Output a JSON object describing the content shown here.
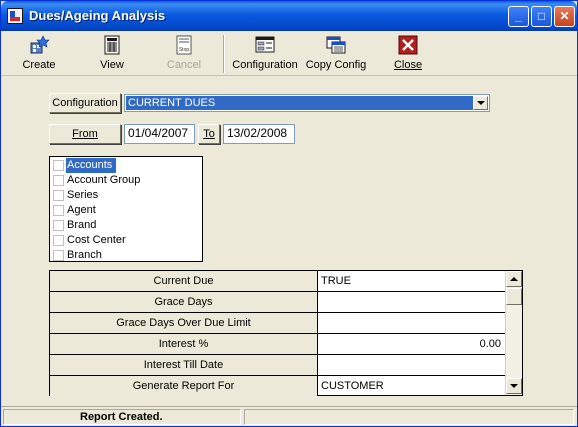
{
  "window": {
    "title": "Dues/Ageing Analysis"
  },
  "titlebar_buttons": {
    "minimize": "_",
    "maximize": "□",
    "close": "✕"
  },
  "toolbar": {
    "items": [
      {
        "label": "Create",
        "icon": "create-icon",
        "enabled": true
      },
      {
        "label": "View",
        "icon": "view-icon",
        "enabled": true
      },
      {
        "label": "Cancel",
        "icon": "cancel-icon",
        "enabled": false
      },
      {
        "label": "Configuration",
        "icon": "configuration-icon",
        "enabled": true
      },
      {
        "label": "Copy Config",
        "icon": "copy-config-icon",
        "enabled": true
      },
      {
        "label": "Close",
        "icon": "close-x-icon",
        "enabled": true
      }
    ],
    "cancel_icon_text": "Stop"
  },
  "config": {
    "label": "Configuration",
    "value": "CURRENT DUES"
  },
  "dates": {
    "from_label": "From",
    "from_value": "01/04/2007",
    "to_label": "To",
    "to_value": "13/02/2008"
  },
  "groupings": {
    "items": [
      {
        "label": "Accounts",
        "checked": false,
        "selected": true
      },
      {
        "label": "Account Group",
        "checked": false,
        "selected": false
      },
      {
        "label": "Series",
        "checked": false,
        "selected": false
      },
      {
        "label": "Agent",
        "checked": false,
        "selected": false
      },
      {
        "label": "Brand",
        "checked": false,
        "selected": false
      },
      {
        "label": "Cost Center",
        "checked": false,
        "selected": false
      },
      {
        "label": "Branch",
        "checked": false,
        "selected": false
      }
    ]
  },
  "properties": {
    "rows": [
      {
        "key": "Current Due",
        "value": "TRUE"
      },
      {
        "key": "Grace Days",
        "value": ""
      },
      {
        "key": "Grace Days Over Due Limit",
        "value": ""
      },
      {
        "key": "Interest %",
        "value": "0.00"
      },
      {
        "key": "Interest Till Date",
        "value": ""
      },
      {
        "key": "Generate Report For",
        "value": "CUSTOMER"
      }
    ]
  },
  "status": {
    "message": "Report Created."
  },
  "colors": {
    "selection": "#316ac5",
    "face": "#ece9d8",
    "title_blue": "#0a5ae0"
  }
}
